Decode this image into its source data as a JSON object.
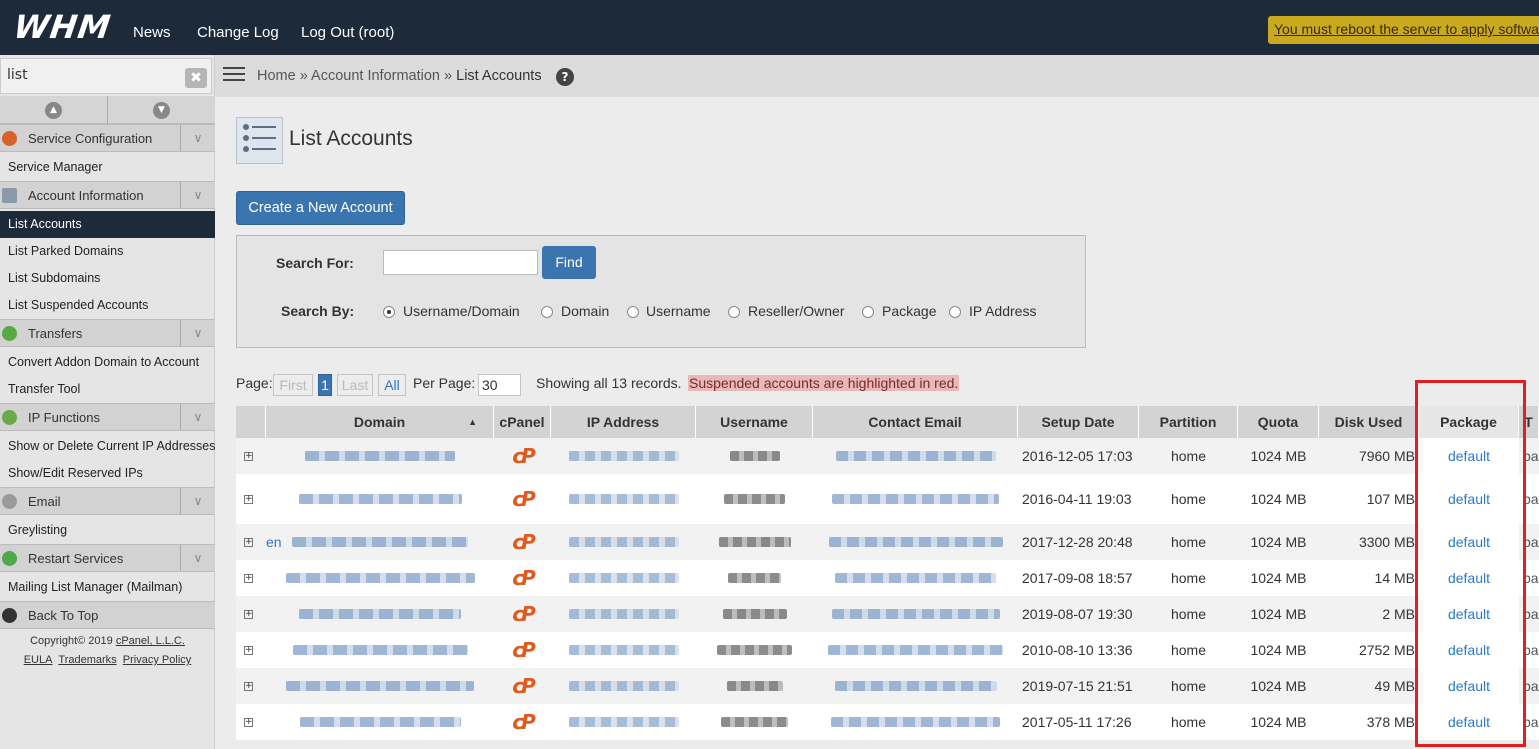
{
  "topbar": {
    "logo": "WHM",
    "nav": [
      "News",
      "Change Log",
      "Log Out (root)"
    ],
    "alert": "You must reboot the server to apply software updates"
  },
  "sidebar": {
    "search_value": "list",
    "clear_label": "✖",
    "categories": [
      {
        "label": "Service Configuration",
        "items": [
          "Service Manager"
        ]
      },
      {
        "label": "Account Information",
        "items": [
          "List Accounts",
          "List Parked Domains",
          "List Subdomains",
          "List Suspended Accounts"
        ]
      },
      {
        "label": "Transfers",
        "items": [
          "Convert Addon Domain to Account",
          "Transfer Tool"
        ]
      },
      {
        "label": "IP Functions",
        "items": [
          "Show or Delete Current IP Addresses",
          "Show/Edit Reserved IPs"
        ]
      },
      {
        "label": "Email",
        "items": [
          "Greylisting"
        ]
      },
      {
        "label": "Restart Services",
        "items": [
          "Mailing List Manager (Mailman)"
        ]
      }
    ],
    "active_item": "List Accounts",
    "back_to_top": "Back To Top",
    "copyright_prefix": "Copyright© 2019 ",
    "copyright_link": "cPanel, L.L.C.",
    "footer_links": [
      "EULA",
      "Trademarks",
      "Privacy Policy"
    ]
  },
  "breadcrumb": {
    "items": [
      "Home",
      "Account Information",
      "List Accounts"
    ],
    "separator": "»",
    "help": "?"
  },
  "page": {
    "title": "List Accounts",
    "create_button": "Create a New Account"
  },
  "search": {
    "for_label": "Search For:",
    "input_value": "",
    "find_label": "Find",
    "by_label": "Search By:",
    "options": [
      "Username/Domain",
      "Domain",
      "Username",
      "Reseller/Owner",
      "Package",
      "IP Address"
    ],
    "selected": "Username/Domain"
  },
  "pagination": {
    "page_label": "Page:",
    "first": "First",
    "current": "1",
    "last": "Last",
    "all": "All",
    "per_page_label": "Per Page:",
    "per_page": "30",
    "showing": "Showing all 13 records.",
    "suspended_note": "Suspended accounts are highlighted in red."
  },
  "table": {
    "columns": [
      "",
      "Domain",
      "cPanel",
      "IP Address",
      "Username",
      "Contact Email",
      "Setup Date",
      "Partition",
      "Quota",
      "Disk Used",
      "Package",
      "T"
    ],
    "sort_indicator": "▲",
    "rows": [
      {
        "setup": "2016-12-05 17:03",
        "partition": "home",
        "quota": "1024 MB",
        "disk": "7960 MB",
        "package": "default",
        "extra": "pa"
      },
      {
        "setup": "2016-04-11 19:03",
        "partition": "home",
        "quota": "1024 MB",
        "disk": "107 MB",
        "package": "default",
        "extra": "pa"
      },
      {
        "setup": "2017-12-28 20:48",
        "partition": "home",
        "quota": "1024 MB",
        "disk": "3300 MB",
        "package": "default",
        "extra": "pa",
        "domain_prefix": "en"
      },
      {
        "setup": "2017-09-08 18:57",
        "partition": "home",
        "quota": "1024 MB",
        "disk": "14 MB",
        "package": "default",
        "extra": "pa"
      },
      {
        "setup": "2019-08-07 19:30",
        "partition": "home",
        "quota": "1024 MB",
        "disk": "2 MB",
        "package": "default",
        "extra": "pa"
      },
      {
        "setup": "2010-08-10 13:36",
        "partition": "home",
        "quota": "1024 MB",
        "disk": "2752 MB",
        "package": "default",
        "extra": "pa"
      },
      {
        "setup": "2019-07-15 21:51",
        "partition": "home",
        "quota": "1024 MB",
        "disk": "49 MB",
        "package": "default",
        "extra": "pa"
      },
      {
        "setup": "2017-05-11 17:26",
        "partition": "home",
        "quota": "1024 MB",
        "disk": "378 MB",
        "package": "default",
        "extra": "pa"
      }
    ]
  },
  "colors": {
    "topbar": "#1c2a3a",
    "primary_button": "#3a75b0",
    "link": "#2a7ac6",
    "cpanel_logo": "#e05a1f",
    "highlight_box": "#e02020",
    "suspended_bg": "#e9b8b8"
  }
}
